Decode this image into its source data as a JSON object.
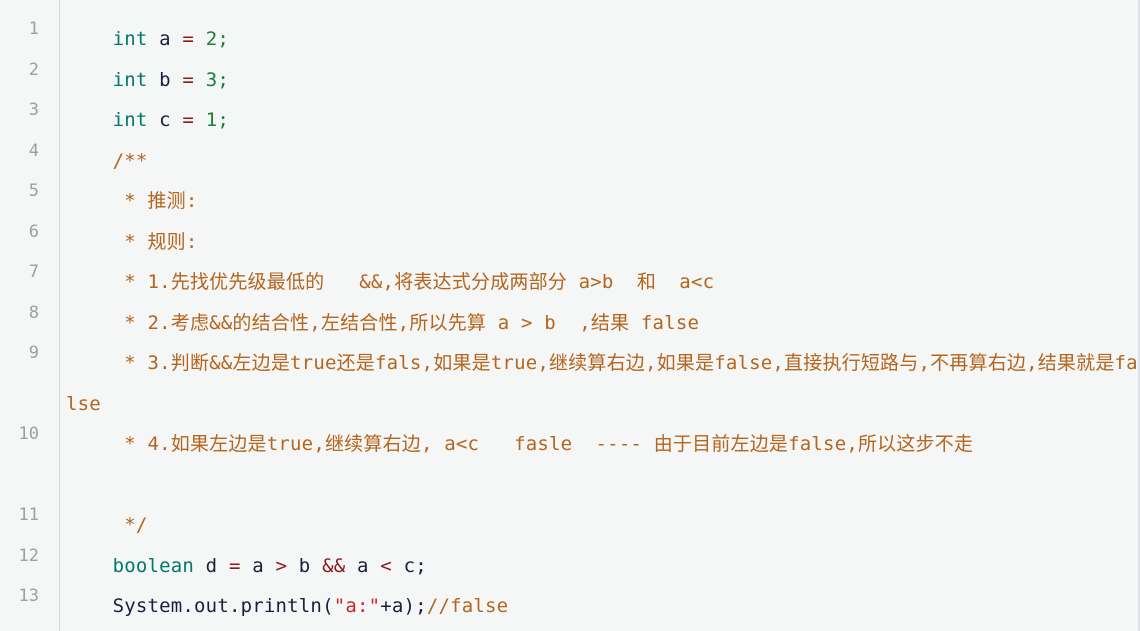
{
  "editor": {
    "language": "java",
    "background_color": "#f5f6f6",
    "gutter_separator_color": "#d6d9dc",
    "line_number_color": "#9aa0a6",
    "colors": {
      "keyword": "#00796b",
      "operator": "#8b1a1a",
      "number": "#1a7f37",
      "string": "#c62828",
      "comment": "#b5651d",
      "plain_text": "#1b1f3b"
    }
  },
  "gutter": {
    "line_numbers": [
      "1",
      "2",
      "3",
      "4",
      "5",
      "6",
      "7",
      "8",
      "9",
      "10",
      "11",
      "12",
      "13"
    ]
  },
  "code": {
    "lines": [
      {
        "number": "1",
        "indent": "    ",
        "text": "int a = 2;",
        "tokens": [
          {
            "t": "    ",
            "c": "plain"
          },
          {
            "t": "int",
            "c": "kw"
          },
          {
            "t": " a ",
            "c": "plain"
          },
          {
            "t": "=",
            "c": "op"
          },
          {
            "t": " ",
            "c": "plain"
          },
          {
            "t": "2;",
            "c": "num"
          }
        ]
      },
      {
        "number": "2",
        "indent": "    ",
        "text": "int b = 3;",
        "tokens": [
          {
            "t": "    ",
            "c": "plain"
          },
          {
            "t": "int",
            "c": "kw"
          },
          {
            "t": " b ",
            "c": "plain"
          },
          {
            "t": "=",
            "c": "op"
          },
          {
            "t": " ",
            "c": "plain"
          },
          {
            "t": "3;",
            "c": "num"
          }
        ]
      },
      {
        "number": "3",
        "indent": "    ",
        "text": "int c = 1;",
        "tokens": [
          {
            "t": "    ",
            "c": "plain"
          },
          {
            "t": "int",
            "c": "kw"
          },
          {
            "t": " c ",
            "c": "plain"
          },
          {
            "t": "=",
            "c": "op"
          },
          {
            "t": " ",
            "c": "plain"
          },
          {
            "t": "1;",
            "c": "num"
          }
        ]
      },
      {
        "number": "4",
        "indent": "    ",
        "text": "/**",
        "tokens": [
          {
            "t": "    ",
            "c": "plain"
          },
          {
            "t": "/**",
            "c": "cmt"
          }
        ]
      },
      {
        "number": "5",
        "indent": "     ",
        "text": "* 推测:",
        "tokens": [
          {
            "t": "     ",
            "c": "plain"
          },
          {
            "t": "* 推测:",
            "c": "cmt"
          }
        ]
      },
      {
        "number": "6",
        "indent": "     ",
        "text": "* 规则:",
        "tokens": [
          {
            "t": "     ",
            "c": "plain"
          },
          {
            "t": "* 规则:",
            "c": "cmt"
          }
        ]
      },
      {
        "number": "7",
        "indent": "     ",
        "text": "* 1.先找优先级最低的   &&,将表达式分成两部分 a>b  和  a<c",
        "tokens": [
          {
            "t": "     ",
            "c": "plain"
          },
          {
            "t": "* 1.先找优先级最低的   &&,将表达式分成两部分 a>b  和  a<c",
            "c": "cmt"
          }
        ]
      },
      {
        "number": "8",
        "indent": "     ",
        "text": "* 2.考虑&&的结合性,左结合性,所以先算 a > b  ,结果 false",
        "tokens": [
          {
            "t": "     ",
            "c": "plain"
          },
          {
            "t": "* 2.考虑&&的结合性,左结合性,所以先算 a > b  ,结果 false",
            "c": "cmt"
          }
        ]
      },
      {
        "number": "9",
        "indent": "     ",
        "text": "* 3.判断&&左边是true还是fals,如果是true,继续算右边,如果是false,直接执行短路与,不再算右边,结果就是false",
        "wrapped": true,
        "tokens": [
          {
            "t": "     ",
            "c": "plain"
          },
          {
            "t": "* 3.判断&&左边是true还是fals,如果是true,继续算右边,如果是false,直接执行短路与,不再算右边,结果就是false",
            "c": "cmt"
          }
        ]
      },
      {
        "number": "10",
        "indent": "     ",
        "text": "* 4.如果左边是true,继续算右边, a<c   fasle  ---- 由于目前左边是false,所以这步不走",
        "wrapped": true,
        "tokens": [
          {
            "t": "     ",
            "c": "plain"
          },
          {
            "t": "* 4.如果左边是true,继续算右边, a<c   fasle  ---- 由于目前左边是false,所以这步不走",
            "c": "cmt"
          }
        ]
      },
      {
        "number": "11",
        "indent": "     ",
        "text": "*/",
        "tokens": [
          {
            "t": "     ",
            "c": "plain"
          },
          {
            "t": "*/",
            "c": "cmt"
          }
        ]
      },
      {
        "number": "12",
        "indent": "    ",
        "text": "boolean d = a > b && a < c;",
        "tokens": [
          {
            "t": "    ",
            "c": "plain"
          },
          {
            "t": "boolean",
            "c": "kw"
          },
          {
            "t": " d ",
            "c": "plain"
          },
          {
            "t": "=",
            "c": "op"
          },
          {
            "t": " a ",
            "c": "plain"
          },
          {
            "t": ">",
            "c": "op"
          },
          {
            "t": " b ",
            "c": "plain"
          },
          {
            "t": "&&",
            "c": "op"
          },
          {
            "t": " a ",
            "c": "plain"
          },
          {
            "t": "<",
            "c": "op"
          },
          {
            "t": " c;",
            "c": "plain"
          }
        ]
      },
      {
        "number": "13",
        "indent": "    ",
        "text": "System.out.println(\"a:\"+a);//false",
        "tokens": [
          {
            "t": "    ",
            "c": "plain"
          },
          {
            "t": "System.out.println(",
            "c": "plain"
          },
          {
            "t": "\"a:\"",
            "c": "str"
          },
          {
            "t": "+a);",
            "c": "plain"
          },
          {
            "t": "//false",
            "c": "cmt"
          }
        ]
      }
    ]
  }
}
